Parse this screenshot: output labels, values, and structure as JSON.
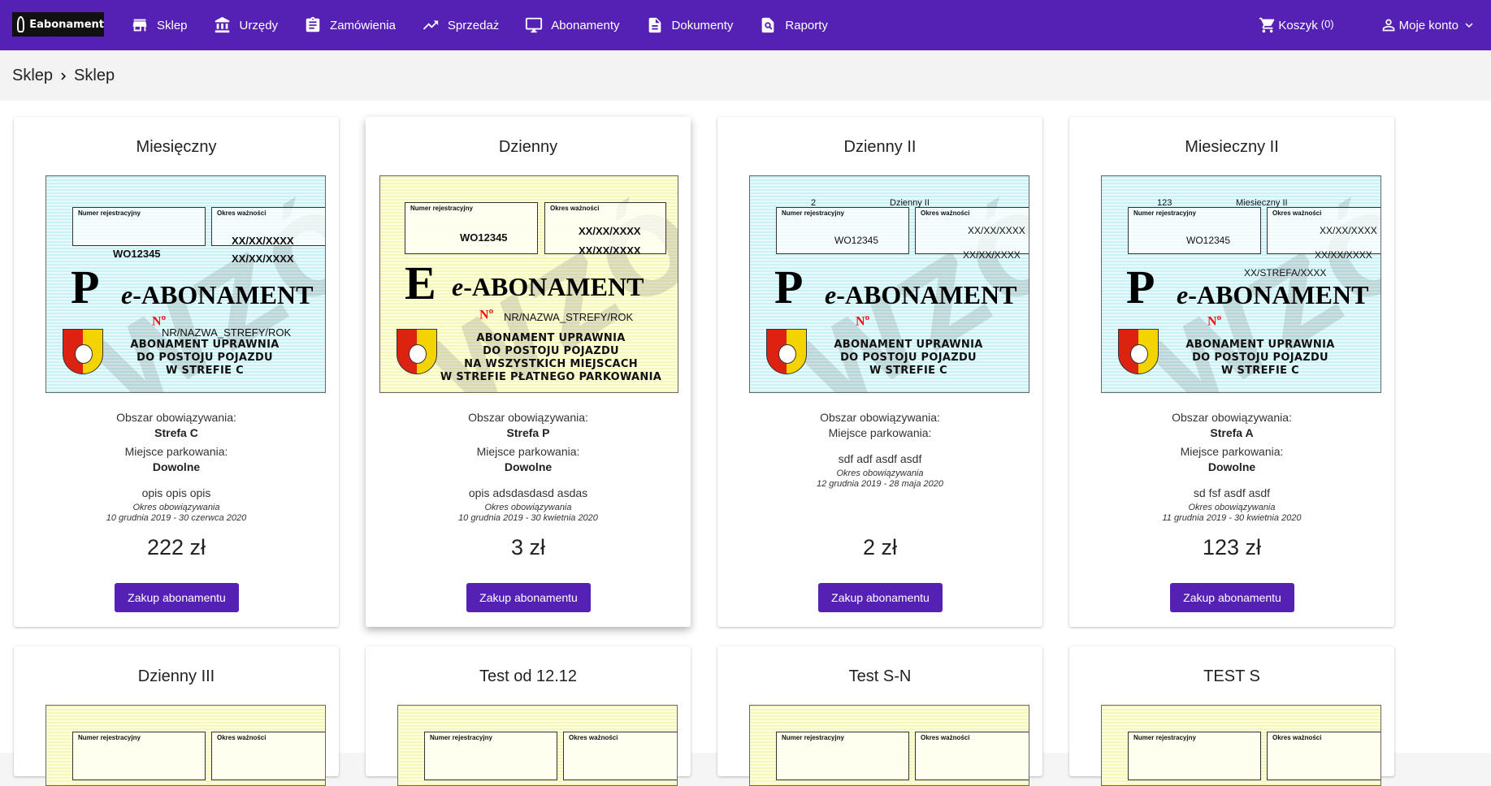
{
  "app": {
    "logo_text": "Eabonament",
    "nav": [
      {
        "label": "Sklep",
        "icon": "store-icon"
      },
      {
        "label": "Urzędy",
        "icon": "bank-icon"
      },
      {
        "label": "Zamówienia",
        "icon": "clipboard-icon"
      },
      {
        "label": "Sprzedaż",
        "icon": "trending-up-icon"
      },
      {
        "label": "Abonamenty",
        "icon": "monitor-icon"
      },
      {
        "label": "Dokumenty",
        "icon": "document-icon"
      },
      {
        "label": "Raporty",
        "icon": "report-search-icon"
      }
    ],
    "cart_label": "Koszyk",
    "cart_count": "(0)",
    "account_label": "Moje konto"
  },
  "breadcrumb": {
    "first": "Sklep",
    "second": "Sklep"
  },
  "colors": {
    "primary": "#5521b5",
    "ticket_blue": "#c9f1f6",
    "ticket_yellow": "#f7f8b8"
  },
  "common": {
    "area_label": "Obszar obowiązywania:",
    "parking_label": "Miejsce parkowania:",
    "period_label": "Okres obowiązywania",
    "buy_button": "Zakup abonamentu",
    "ticket_reg_label": "Numer rejestracyjny",
    "ticket_valid_label": "Okres ważności",
    "ticket_brand_e": "e",
    "ticket_brand_rest": "-ABONAMENT",
    "ticket_no": "N",
    "ticket_no_sup": "o",
    "watermark": "WZÓR"
  },
  "cards": [
    {
      "title": "Miesięczny",
      "ticket": {
        "letter": "P",
        "plate": "WO12345",
        "date1": "XX/XX/XXXX",
        "date2": "XX/XX/XXXX",
        "zone": "NR/NAZWA_STREFY/ROK",
        "desc": "ABONAMENT UPRAWNIA\nDO POSTOJU POJAZDU\nW STREFIE C"
      },
      "area": "Strefa C",
      "parking": "Dowolne",
      "description": "opis opis opis",
      "period": "10 grudnia 2019 - 30 czerwca 2020",
      "price": "222 zł"
    },
    {
      "title": "Dzienny",
      "ticket": {
        "letter": "E",
        "plate": "WO12345",
        "date1": "XX/XX/XXXX",
        "date2": "XX/XX/XXXX",
        "zone": "NR/NAZWA_STREFY/ROK",
        "desc": "ABONAMENT UPRAWNIA\nDO POSTOJU POJAZDU\nNA WSZYSTKICH MIEJSCACH\nW STREFIE PŁATNEGO PARKOWANIA"
      },
      "area": "Strefa P",
      "parking": "Dowolne",
      "description": "opis adsdasdasd asdas",
      "period": "10 grudnia 2019 - 30 kwietnia 2020",
      "price": "3 zł"
    },
    {
      "title": "Dzienny II",
      "ticket": {
        "letter": "P",
        "top_num": "2",
        "top_name": "Dzienny II",
        "plate": "WO12345",
        "date1": "XX/XX/XXXX",
        "date2": "XX/XX/XXXX",
        "desc": "ABONAMENT UPRAWNIA\nDO POSTOJU POJAZDU\nW STREFIE C"
      },
      "area": "",
      "parking": "",
      "description": "sdf adf asdf asdf",
      "period": "12 grudnia 2019 - 28 maja 2020",
      "price": "2 zł"
    },
    {
      "title": "Miesieczny II",
      "ticket": {
        "letter": "P",
        "top_num": "123",
        "top_name": "Miesieczny II",
        "plate": "WO12345",
        "date1": "XX/XX/XXXX",
        "date2": "XX/XX/XXXX",
        "zone": "XX/STREFA/XXXX",
        "desc": "ABONAMENT UPRAWNIA\nDO POSTOJU POJAZDU\nW STREFIE C"
      },
      "area": "Strefa A",
      "parking": "Dowolne",
      "description": "sd fsf asdf asdf",
      "period": "11 grudnia 2019 - 30 kwietnia 2020",
      "price": "123 zł"
    }
  ],
  "cards_row2": [
    {
      "title": "Dzienny III"
    },
    {
      "title": "Test od 12.12"
    },
    {
      "title": "Test S-N"
    },
    {
      "title": "TEST S"
    }
  ]
}
